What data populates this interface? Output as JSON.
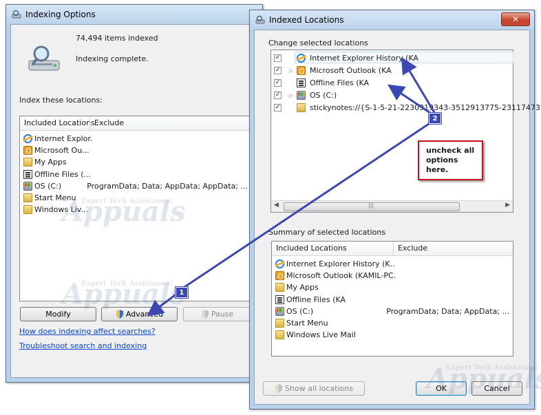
{
  "indexing_options": {
    "title": "Indexing Options",
    "items_indexed": "74,494 items indexed",
    "status": "Indexing complete.",
    "index_these_label": "Index these locations:",
    "col_included": "Included Locations",
    "col_exclude": "Exclude",
    "rows": [
      {
        "icon": "ie-icon",
        "name": "Internet Explor...",
        "exclude": ""
      },
      {
        "icon": "outlook-icon",
        "name": "Microsoft Ou...",
        "exclude": ""
      },
      {
        "icon": "folder-icon",
        "name": "My Apps",
        "exclude": ""
      },
      {
        "icon": "offline-files-icon",
        "name": "Offline Files (...",
        "exclude": ""
      },
      {
        "icon": "drive-icon",
        "name": "OS (C:)",
        "exclude": "ProgramData; Data; AppData; AppData; ..."
      },
      {
        "icon": "folder-icon",
        "name": "Start Menu",
        "exclude": ""
      },
      {
        "icon": "folder-icon",
        "name": "Windows Liv...",
        "exclude": ""
      }
    ],
    "modify_label": "Modify",
    "advanced_label": "Advanced",
    "pause_label": "Pause",
    "link_how": "How does indexing affect searches?",
    "link_troubleshoot": "Troubleshoot search and indexing"
  },
  "indexed_locations": {
    "title": "Indexed Locations",
    "change_label": "Change selected locations",
    "tree": [
      {
        "icon": "ie-icon",
        "name": "Internet Explorer History (KA",
        "checked": true,
        "expandable": false
      },
      {
        "icon": "outlook-icon",
        "name": "Microsoft Outlook (KA",
        "checked": true,
        "expandable": true
      },
      {
        "icon": "offline-files-icon",
        "name": "Offline Files (KA",
        "checked": true,
        "expandable": false
      },
      {
        "icon": "drive-icon",
        "name": "OS (C:)",
        "checked": true,
        "expandable": true
      },
      {
        "icon": "folder-icon",
        "name": "stickynotes://{S-1-5-21-2230319343-3512913775-23117473",
        "checked": true,
        "expandable": false
      }
    ],
    "summary_label": "Summary of selected locations",
    "col_included": "Included Locations",
    "col_exclude": "Exclude",
    "summary_rows": [
      {
        "icon": "ie-icon",
        "name": "Internet Explorer History (K...",
        "exclude": ""
      },
      {
        "icon": "outlook-icon",
        "name": "Microsoft Outlook (KAMIL-PC...",
        "exclude": ""
      },
      {
        "icon": "folder-icon",
        "name": "My Apps",
        "exclude": ""
      },
      {
        "icon": "offline-files-icon",
        "name": "Offline Files (KA",
        "exclude": ""
      },
      {
        "icon": "drive-icon",
        "name": "OS (C:)",
        "exclude": "ProgramData; Data; AppData; ..."
      },
      {
        "icon": "folder-icon",
        "name": "Start Menu",
        "exclude": ""
      },
      {
        "icon": "folder-icon",
        "name": "Windows Live Mail",
        "exclude": ""
      }
    ],
    "show_all_label": "Show all locations",
    "ok_label": "OK",
    "cancel_label": "Cancel",
    "close_glyph": "✕"
  },
  "annotation": {
    "note": "uncheck all options here.",
    "badge1": "1",
    "badge2": "2",
    "arrow_color": "#3b47b3",
    "box_border": "#c6141a"
  },
  "watermark": {
    "main": "Appuals",
    "tagline": "Expert Tech Assistance!"
  },
  "colors": {
    "window_frame": "#b9d1ea",
    "client_bg": "#f0f0f0",
    "link": "#0645d6"
  }
}
